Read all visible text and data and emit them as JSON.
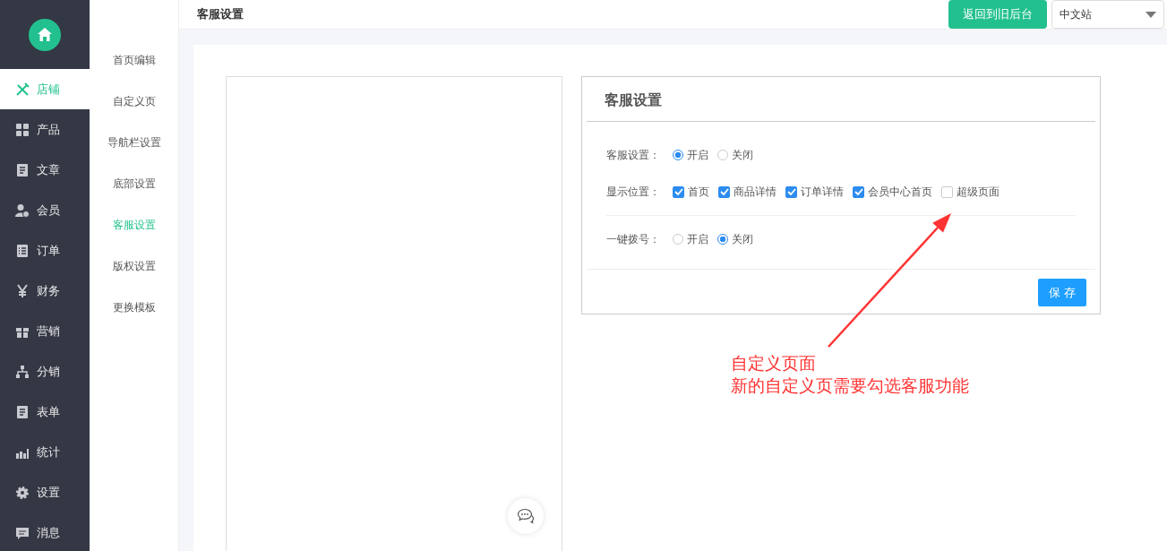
{
  "header": {
    "title": "客服设置",
    "back_button": "返回到旧后台",
    "site_select": "中文站"
  },
  "nav": [
    {
      "label": "店铺",
      "kind": "tools",
      "selected": true
    },
    {
      "label": "产品",
      "kind": "grid",
      "selected": false
    },
    {
      "label": "文章",
      "kind": "doc",
      "selected": false
    },
    {
      "label": "会员",
      "kind": "user",
      "selected": false
    },
    {
      "label": "订单",
      "kind": "list",
      "selected": false
    },
    {
      "label": "财务",
      "kind": "yen",
      "selected": false
    },
    {
      "label": "营销",
      "kind": "gift",
      "selected": false
    },
    {
      "label": "分销",
      "kind": "tree",
      "selected": false
    },
    {
      "label": "表单",
      "kind": "doc",
      "selected": false
    },
    {
      "label": "统计",
      "kind": "chart",
      "selected": false
    },
    {
      "label": "设置",
      "kind": "gear",
      "selected": false
    },
    {
      "label": "消息",
      "kind": "message",
      "selected": false
    }
  ],
  "submenu": [
    {
      "label": "首页编辑",
      "selected": false
    },
    {
      "label": "自定义页",
      "selected": false
    },
    {
      "label": "导航栏设置",
      "selected": false
    },
    {
      "label": "底部设置",
      "selected": false
    },
    {
      "label": "客服设置",
      "selected": true
    },
    {
      "label": "版权设置",
      "selected": false
    },
    {
      "label": "更换模板",
      "selected": false
    }
  ],
  "card": {
    "title": "客服设置",
    "rows": [
      {
        "kind": "radio",
        "label": "客服设置：",
        "options": [
          {
            "label": "开启",
            "selected": true
          },
          {
            "label": "关闭",
            "selected": false
          }
        ]
      },
      {
        "kind": "checkbox",
        "label": "显示位置：",
        "options": [
          {
            "label": "首页",
            "checked": true
          },
          {
            "label": "商品详情",
            "checked": true
          },
          {
            "label": "订单详情",
            "checked": true
          },
          {
            "label": "会员中心首页",
            "checked": true
          },
          {
            "label": "超级页面",
            "checked": false
          }
        ]
      },
      {
        "kind": "radio",
        "label": "一键拨号：",
        "options": [
          {
            "label": "开启",
            "selected": false
          },
          {
            "label": "关闭",
            "selected": true
          }
        ]
      }
    ],
    "save_button": "保 存"
  },
  "annotation": {
    "lines": [
      "自定义页面",
      "新的自定义页需要勾选客服功能"
    ]
  }
}
